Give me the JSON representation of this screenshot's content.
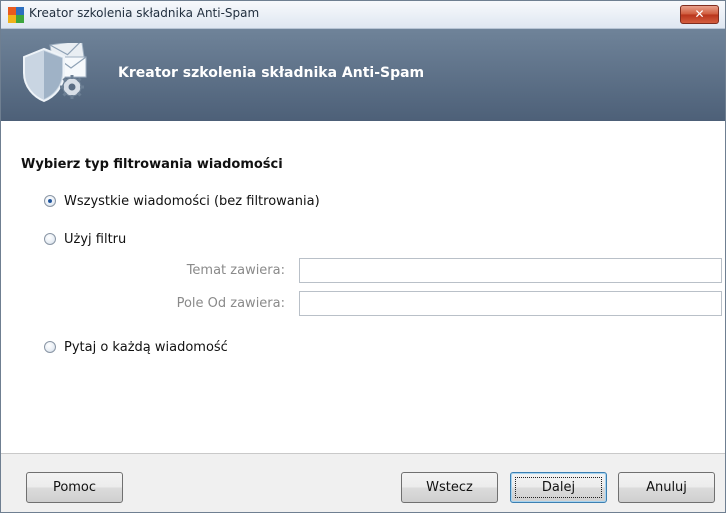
{
  "window": {
    "title": "Kreator szkolenia składnika Anti-Spam",
    "close_label": "✕"
  },
  "header": {
    "title": "Kreator szkolenia składnika Anti-Spam",
    "icon": "shield-envelope-gear-icon"
  },
  "content": {
    "heading": "Wybierz typ filtrowania wiadomości",
    "options": [
      {
        "label": "Wszystkie wiadomości (bez filtrowania)",
        "selected": true
      },
      {
        "label": "Użyj filtru",
        "selected": false
      },
      {
        "label": "Pytaj o każdą wiadomość",
        "selected": false
      }
    ],
    "filter": {
      "subject_label": "Temat zawiera:",
      "subject_value": "",
      "from_label": "Pole Od zawiera:",
      "from_value": ""
    }
  },
  "footer": {
    "help_label": "Pomoc",
    "back_label": "Wstecz",
    "next_label": "Dalej",
    "cancel_label": "Anuluj"
  },
  "colors": {
    "header_band": "#5a6d84",
    "close_button": "#c8452a",
    "default_button_border": "#3c7fb1"
  }
}
